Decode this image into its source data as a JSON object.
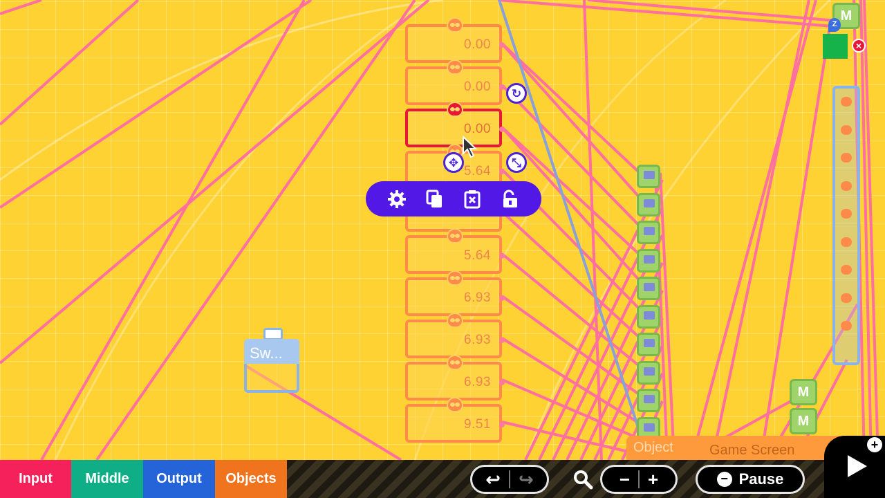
{
  "canvas": {
    "constant_nodes": [
      {
        "value": "0.00",
        "selected": false
      },
      {
        "value": "0.00",
        "selected": false
      },
      {
        "value": "0.00",
        "selected": true
      },
      {
        "value": "5.64",
        "selected": false
      },
      {
        "value": "",
        "selected": false
      },
      {
        "value": "5.64",
        "selected": false
      },
      {
        "value": "6.93",
        "selected": false
      },
      {
        "value": "6.93",
        "selected": false
      },
      {
        "value": "6.93",
        "selected": false
      },
      {
        "value": "9.51",
        "selected": false
      }
    ],
    "switch_node": {
      "label": "Sw..."
    },
    "m_nodes": [
      "M",
      "M",
      "M"
    ],
    "object_chip": {
      "label": "Object",
      "sub": "Game Screen"
    },
    "z_pin": "Z",
    "close_badge": "×"
  },
  "node_toolbar": {
    "icons": [
      "gear-icon",
      "copy-icon",
      "delete-icon",
      "unlock-icon"
    ]
  },
  "floating_buttons": {
    "rotate": "↻",
    "move": "✥",
    "resize": "⤡"
  },
  "bottom_bar": {
    "tabs": [
      {
        "label": "Input",
        "color": "#f5215b"
      },
      {
        "label": "Middle",
        "color": "#10ae86"
      },
      {
        "label": "Output",
        "color": "#2463d8"
      },
      {
        "label": "Objects",
        "color": "#f0731e"
      }
    ],
    "undo": "↩",
    "redo": "↪",
    "zoom_out": "−",
    "zoom_in": "+",
    "pause_label": "Pause",
    "play_plus": "+"
  },
  "colors": {
    "background": "#ffd233",
    "wire": "#ff6fa0",
    "wire_blue": "#8aa0d8",
    "toolbar": "#5218e6",
    "node_border": "#ff8a4a",
    "node_selected": "#e8173a"
  }
}
